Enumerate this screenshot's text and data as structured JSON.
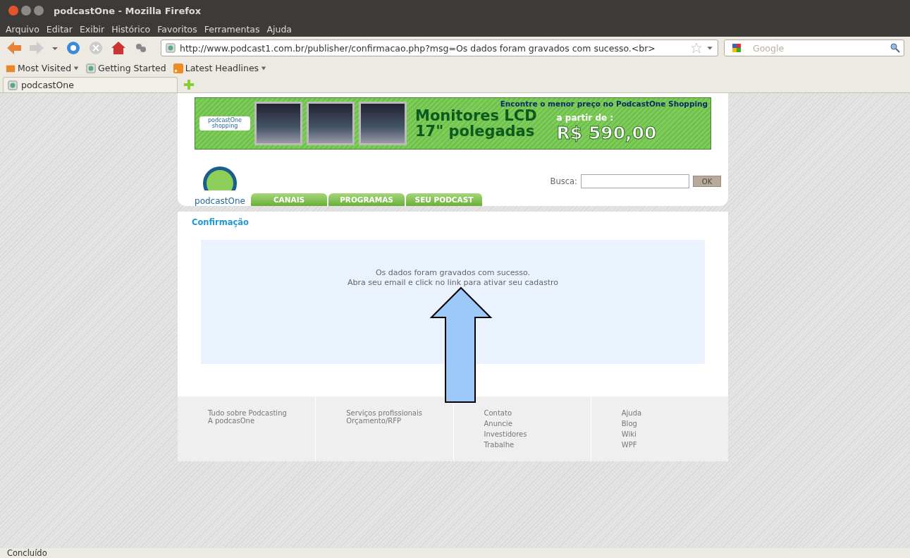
{
  "window": {
    "title": "podcastOne - Mozilla Firefox"
  },
  "menu": [
    "Arquivo",
    "Editar",
    "Exibir",
    "Histórico",
    "Favoritos",
    "Ferramentas",
    "Ajuda"
  ],
  "address": {
    "value": "http://www.podcast1.com.br/publisher/confirmacao.php?msg=Os dados foram gravados com sucesso.<br>"
  },
  "search": {
    "placeholder": "Google"
  },
  "bookmarks": [
    {
      "label": "Most Visited",
      "kind": "folder"
    },
    {
      "label": "Getting Started",
      "kind": "page"
    },
    {
      "label": "Latest Headlines",
      "kind": "feed"
    }
  ],
  "tabs": [
    {
      "label": "podcastOne",
      "selected": true
    }
  ],
  "banner": {
    "logo_top": "podcastOne",
    "logo_bottom": "shopping",
    "tagline": "Encontre o menor preço no PodcastOne Shopping",
    "product_line1": "Monitores LCD",
    "product_line2": "17\" polegadas",
    "price_label": "a partir de :",
    "price": "R$ 590,00"
  },
  "site": {
    "logo": "podcastOne",
    "nav": [
      "CANAIS",
      "PROGRAMAS",
      "SEU PODCAST"
    ],
    "search_label": "Busca:",
    "search_button": "OK"
  },
  "content": {
    "heading": "Confirmação",
    "message_line1": "Os dados foram gravados com sucesso.",
    "message_line2": "Abra seu email e click no link para ativar seu cadastro"
  },
  "footer": [
    [
      "Tudo sobre Podcasting",
      "A podcasOne"
    ],
    [
      "Serviços profissionais",
      "Orçamento/RFP"
    ],
    [
      "Contato",
      "Anuncie",
      "Investidores",
      "Trabalhe"
    ],
    [
      "Ajuda",
      "Blog",
      "Wiki",
      "WPF"
    ]
  ],
  "status_bar": "Concluído"
}
